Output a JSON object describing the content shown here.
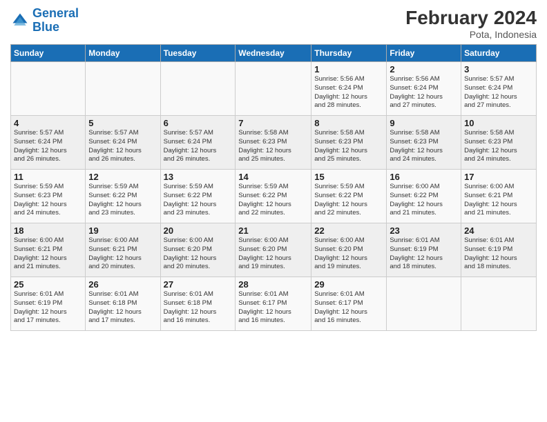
{
  "logo": {
    "line1": "General",
    "line2": "Blue"
  },
  "title": "February 2024",
  "subtitle": "Pota, Indonesia",
  "days_of_week": [
    "Sunday",
    "Monday",
    "Tuesday",
    "Wednesday",
    "Thursday",
    "Friday",
    "Saturday"
  ],
  "weeks": [
    [
      {
        "day": "",
        "info": ""
      },
      {
        "day": "",
        "info": ""
      },
      {
        "day": "",
        "info": ""
      },
      {
        "day": "",
        "info": ""
      },
      {
        "day": "1",
        "info": "Sunrise: 5:56 AM\nSunset: 6:24 PM\nDaylight: 12 hours\nand 28 minutes."
      },
      {
        "day": "2",
        "info": "Sunrise: 5:56 AM\nSunset: 6:24 PM\nDaylight: 12 hours\nand 27 minutes."
      },
      {
        "day": "3",
        "info": "Sunrise: 5:57 AM\nSunset: 6:24 PM\nDaylight: 12 hours\nand 27 minutes."
      }
    ],
    [
      {
        "day": "4",
        "info": "Sunrise: 5:57 AM\nSunset: 6:24 PM\nDaylight: 12 hours\nand 26 minutes."
      },
      {
        "day": "5",
        "info": "Sunrise: 5:57 AM\nSunset: 6:24 PM\nDaylight: 12 hours\nand 26 minutes."
      },
      {
        "day": "6",
        "info": "Sunrise: 5:57 AM\nSunset: 6:24 PM\nDaylight: 12 hours\nand 26 minutes."
      },
      {
        "day": "7",
        "info": "Sunrise: 5:58 AM\nSunset: 6:23 PM\nDaylight: 12 hours\nand 25 minutes."
      },
      {
        "day": "8",
        "info": "Sunrise: 5:58 AM\nSunset: 6:23 PM\nDaylight: 12 hours\nand 25 minutes."
      },
      {
        "day": "9",
        "info": "Sunrise: 5:58 AM\nSunset: 6:23 PM\nDaylight: 12 hours\nand 24 minutes."
      },
      {
        "day": "10",
        "info": "Sunrise: 5:58 AM\nSunset: 6:23 PM\nDaylight: 12 hours\nand 24 minutes."
      }
    ],
    [
      {
        "day": "11",
        "info": "Sunrise: 5:59 AM\nSunset: 6:23 PM\nDaylight: 12 hours\nand 24 minutes."
      },
      {
        "day": "12",
        "info": "Sunrise: 5:59 AM\nSunset: 6:22 PM\nDaylight: 12 hours\nand 23 minutes."
      },
      {
        "day": "13",
        "info": "Sunrise: 5:59 AM\nSunset: 6:22 PM\nDaylight: 12 hours\nand 23 minutes."
      },
      {
        "day": "14",
        "info": "Sunrise: 5:59 AM\nSunset: 6:22 PM\nDaylight: 12 hours\nand 22 minutes."
      },
      {
        "day": "15",
        "info": "Sunrise: 5:59 AM\nSunset: 6:22 PM\nDaylight: 12 hours\nand 22 minutes."
      },
      {
        "day": "16",
        "info": "Sunrise: 6:00 AM\nSunset: 6:22 PM\nDaylight: 12 hours\nand 21 minutes."
      },
      {
        "day": "17",
        "info": "Sunrise: 6:00 AM\nSunset: 6:21 PM\nDaylight: 12 hours\nand 21 minutes."
      }
    ],
    [
      {
        "day": "18",
        "info": "Sunrise: 6:00 AM\nSunset: 6:21 PM\nDaylight: 12 hours\nand 21 minutes."
      },
      {
        "day": "19",
        "info": "Sunrise: 6:00 AM\nSunset: 6:21 PM\nDaylight: 12 hours\nand 20 minutes."
      },
      {
        "day": "20",
        "info": "Sunrise: 6:00 AM\nSunset: 6:20 PM\nDaylight: 12 hours\nand 20 minutes."
      },
      {
        "day": "21",
        "info": "Sunrise: 6:00 AM\nSunset: 6:20 PM\nDaylight: 12 hours\nand 19 minutes."
      },
      {
        "day": "22",
        "info": "Sunrise: 6:00 AM\nSunset: 6:20 PM\nDaylight: 12 hours\nand 19 minutes."
      },
      {
        "day": "23",
        "info": "Sunrise: 6:01 AM\nSunset: 6:19 PM\nDaylight: 12 hours\nand 18 minutes."
      },
      {
        "day": "24",
        "info": "Sunrise: 6:01 AM\nSunset: 6:19 PM\nDaylight: 12 hours\nand 18 minutes."
      }
    ],
    [
      {
        "day": "25",
        "info": "Sunrise: 6:01 AM\nSunset: 6:19 PM\nDaylight: 12 hours\nand 17 minutes."
      },
      {
        "day": "26",
        "info": "Sunrise: 6:01 AM\nSunset: 6:18 PM\nDaylight: 12 hours\nand 17 minutes."
      },
      {
        "day": "27",
        "info": "Sunrise: 6:01 AM\nSunset: 6:18 PM\nDaylight: 12 hours\nand 16 minutes."
      },
      {
        "day": "28",
        "info": "Sunrise: 6:01 AM\nSunset: 6:17 PM\nDaylight: 12 hours\nand 16 minutes."
      },
      {
        "day": "29",
        "info": "Sunrise: 6:01 AM\nSunset: 6:17 PM\nDaylight: 12 hours\nand 16 minutes."
      },
      {
        "day": "",
        "info": ""
      },
      {
        "day": "",
        "info": ""
      }
    ]
  ]
}
